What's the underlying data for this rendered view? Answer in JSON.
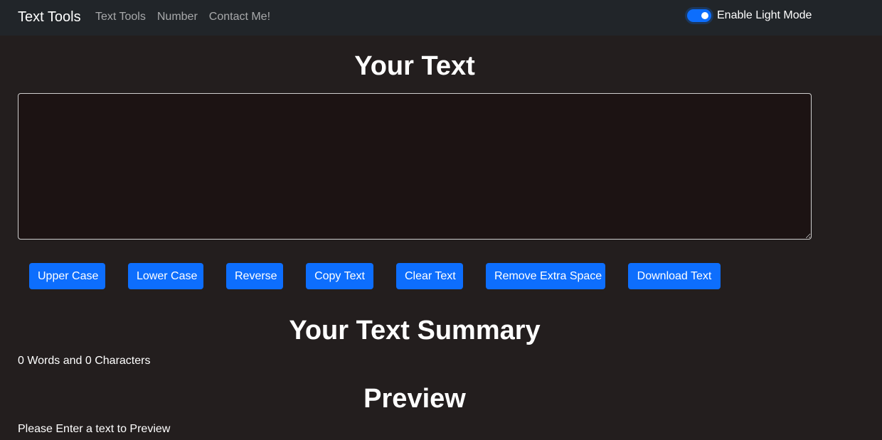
{
  "navbar": {
    "brand": "Text Tools",
    "links": [
      "Text Tools",
      "Number",
      "Contact Me!"
    ],
    "mode_label": "Enable Light Mode",
    "mode_enabled": true
  },
  "main": {
    "title": "Your Text",
    "textarea_value": "",
    "buttons": [
      "Upper Case",
      "Lower Case",
      "Reverse",
      "Copy Text",
      "Clear Text",
      "Remove Extra Space",
      "Download Text"
    ]
  },
  "summary": {
    "title": "Your Text Summary",
    "stats": "0 Words and 0 Characters"
  },
  "preview": {
    "title": "Preview",
    "text": "Please Enter a text to Preview"
  },
  "colors": {
    "background": "#231e1e",
    "navbar": "#212529",
    "accent": "#0d6efd",
    "textarea_bg": "#1c1313"
  }
}
